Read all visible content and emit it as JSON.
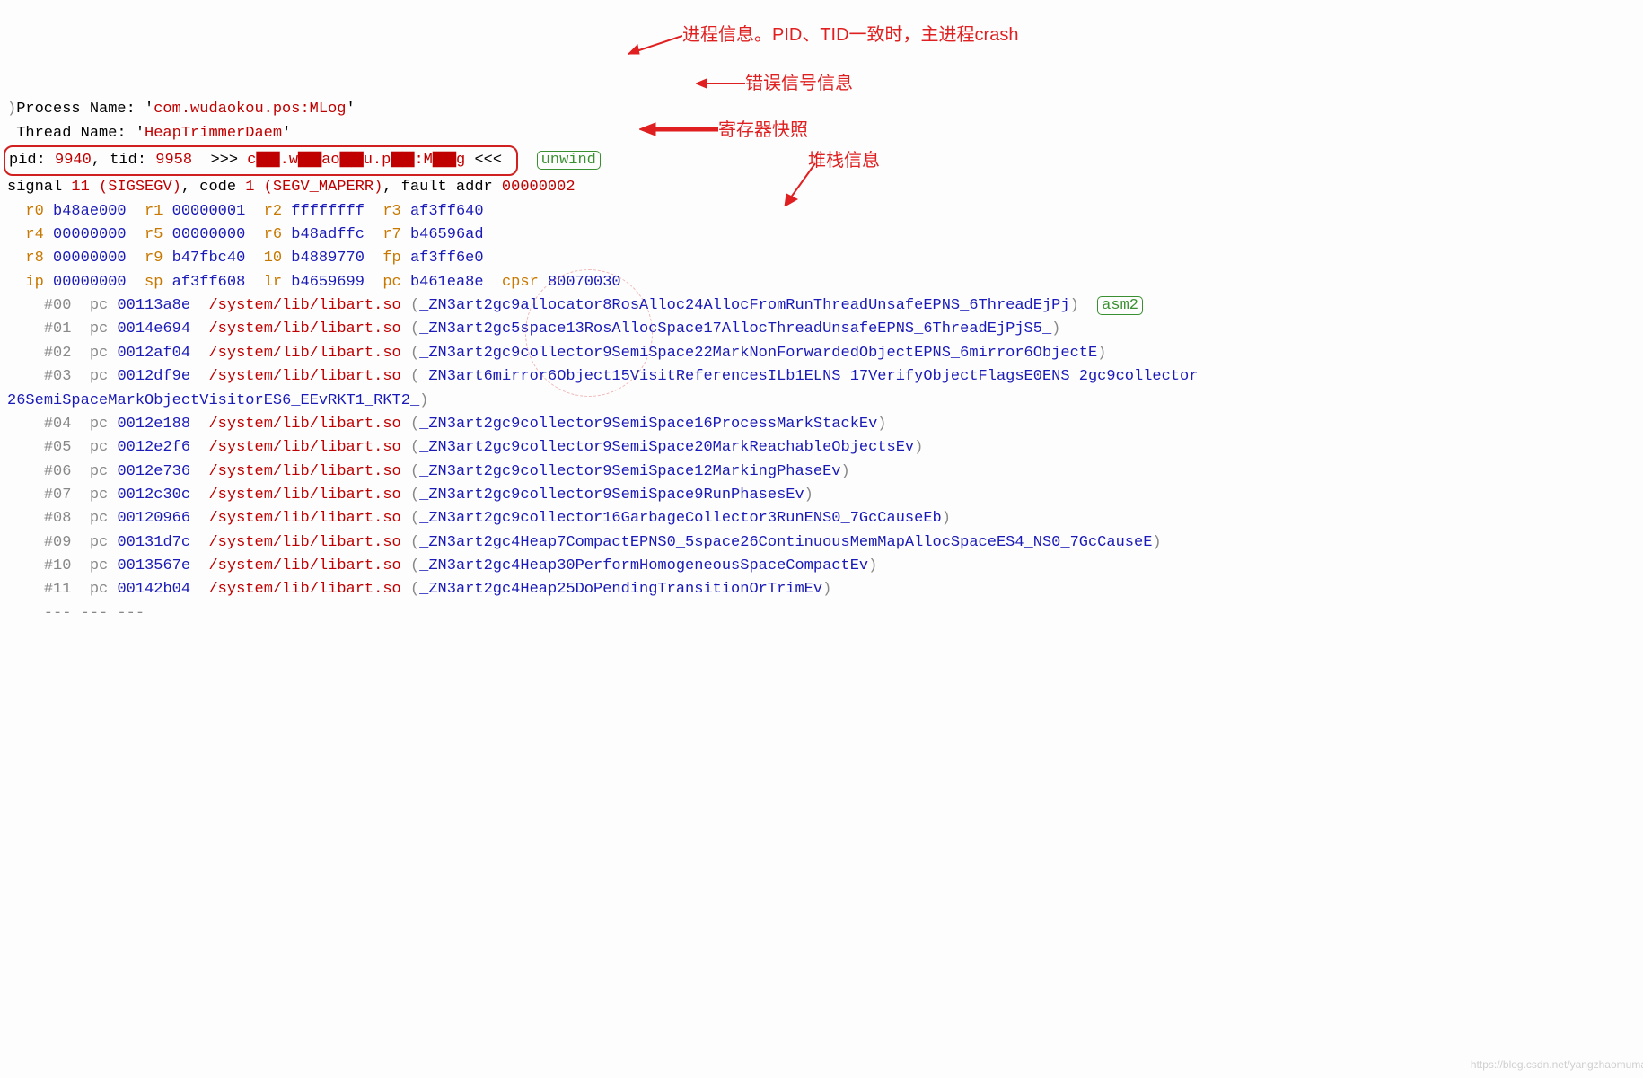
{
  "header": {
    "process_label": "Process Name: '",
    "process_name": "com.wudaokou.pos:MLog",
    "thread_label": "Thread Name: '",
    "thread_name": "HeapTrimmerDaem",
    "close": "'"
  },
  "pidline": {
    "pid_label": "pid: ",
    "pid": "9940",
    "tid_label": ", tid: ",
    "tid": "9958",
    "arrows_l": "  >>> ",
    "proc_masked": "c▇▇.w▇▇ao▇▇u.p▇▇:M▇▇g",
    "arrows_r": " <<< ",
    "unwind": "unwind"
  },
  "signal": {
    "prefix": "signal ",
    "sig": "11 (SIGSEGV)",
    "mid": ", code ",
    "code": "1 (SEGV_MAPERR)",
    "fault_label": ", fault addr ",
    "fault": "00000002"
  },
  "regs": [
    [
      [
        "r0",
        "b48ae000"
      ],
      [
        "r1",
        "00000001"
      ],
      [
        "r2",
        "ffffffff"
      ],
      [
        "r3",
        "af3ff640"
      ]
    ],
    [
      [
        "r4",
        "00000000"
      ],
      [
        "r5",
        "00000000"
      ],
      [
        "r6",
        "b48adffc"
      ],
      [
        "r7",
        "b46596ad"
      ]
    ],
    [
      [
        "r8",
        "00000000"
      ],
      [
        "r9",
        "b47fbc40"
      ],
      [
        "10",
        "b4889770"
      ],
      [
        "fp",
        "af3ff6e0"
      ]
    ],
    [
      [
        "ip",
        "00000000"
      ],
      [
        "sp",
        "af3ff608"
      ],
      [
        "lr",
        "b4659699"
      ],
      [
        "pc",
        "b461ea8e"
      ],
      [
        "cpsr",
        "80070030"
      ]
    ]
  ],
  "frames": [
    {
      "idx": "#00",
      "pc": "00113a8e",
      "so": "/system/lib/libart.so",
      "sym": "_ZN3art2gc9allocator8RosAlloc24AllocFromRunThreadUnsafeEPNS_6ThreadEjPj",
      "asm": "asm2"
    },
    {
      "idx": "#01",
      "pc": "0014e694",
      "so": "/system/lib/libart.so",
      "sym": "_ZN3art2gc5space13RosAllocSpace17AllocThreadUnsafeEPNS_6ThreadEjPjS5_"
    },
    {
      "idx": "#02",
      "pc": "0012af04",
      "so": "/system/lib/libart.so",
      "sym": "_ZN3art2gc9collector9SemiSpace22MarkNonForwardedObjectEPNS_6mirror6ObjectE"
    },
    {
      "idx": "#03",
      "pc": "0012df9e",
      "so": "/system/lib/libart.so",
      "sym": "_ZN3art6mirror6Object15VisitReferencesILb1ELNS_17VerifyObjectFlagsE0ENS_2gc9collector26SemiSpaceMarkObjectVisitorES6_EEvRKT1_RKT2_"
    },
    {
      "idx": "#04",
      "pc": "0012e188",
      "so": "/system/lib/libart.so",
      "sym": "_ZN3art2gc9collector9SemiSpace16ProcessMarkStackEv"
    },
    {
      "idx": "#05",
      "pc": "0012e2f6",
      "so": "/system/lib/libart.so",
      "sym": "_ZN3art2gc9collector9SemiSpace20MarkReachableObjectsEv"
    },
    {
      "idx": "#06",
      "pc": "0012e736",
      "so": "/system/lib/libart.so",
      "sym": "_ZN3art2gc9collector9SemiSpace12MarkingPhaseEv"
    },
    {
      "idx": "#07",
      "pc": "0012c30c",
      "so": "/system/lib/libart.so",
      "sym": "_ZN3art2gc9collector9SemiSpace9RunPhasesEv"
    },
    {
      "idx": "#08",
      "pc": "00120966",
      "so": "/system/lib/libart.so",
      "sym": "_ZN3art2gc9collector16GarbageCollector3RunENS0_7GcCauseEb"
    },
    {
      "idx": "#09",
      "pc": "00131d7c",
      "so": "/system/lib/libart.so",
      "sym": "_ZN3art2gc4Heap7CompactEPNS0_5space26ContinuousMemMapAllocSpaceES4_NS0_7GcCauseE"
    },
    {
      "idx": "#10",
      "pc": "0013567e",
      "so": "/system/lib/libart.so",
      "sym": "_ZN3art2gc4Heap30PerformHomogeneousSpaceCompactEv"
    },
    {
      "idx": "#11",
      "pc": "00142b04",
      "so": "/system/lib/libart.so",
      "sym": "_ZN3art2gc4Heap25DoPendingTransitionOrTrimEv"
    }
  ],
  "tail": "    --- --- ---",
  "annotations": {
    "proc_info": "进程信息。PID、TID一致时，主进程crash",
    "signal_info": "错误信号信息",
    "register_snap": "寄存器快照",
    "stack_info": "堆栈信息"
  },
  "watermark": "https://blog.csdn.net/yangzhaomuma"
}
